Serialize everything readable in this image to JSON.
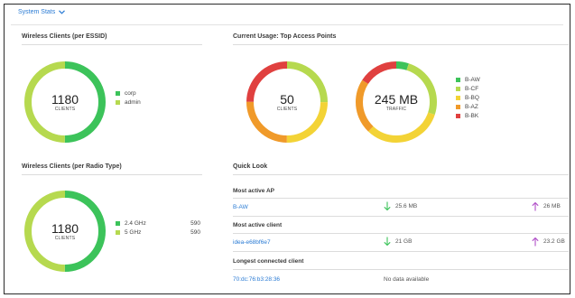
{
  "header": {
    "title": "System Stats"
  },
  "panels": {
    "clients_ssid": {
      "title": "Wireless Clients (per ESSID)",
      "total": "1180",
      "unit": "CLIENTS",
      "legend": [
        {
          "label": "corp",
          "color": "#3cc35a",
          "fraction": 0.5
        },
        {
          "label": "admin",
          "color": "#b6d94f",
          "fraction": 0.5
        }
      ]
    },
    "top_aps": {
      "title": "Current Usage: Top Access Points",
      "clients_total": "50",
      "clients_unit": "CLIENTS",
      "traffic_total": "245 MB",
      "traffic_unit": "TRAFFIC",
      "legend": [
        {
          "label": "B-AW",
          "color": "#3cc35a"
        },
        {
          "label": "B-CF",
          "color": "#b6d94f"
        },
        {
          "label": "B-BQ",
          "color": "#f3d336"
        },
        {
          "label": "B-AZ",
          "color": "#f09a2a"
        },
        {
          "label": "B-BK",
          "color": "#e0403f"
        }
      ],
      "clients_fractions": [
        0.0,
        0.25,
        0.25,
        0.25,
        0.25
      ],
      "traffic_fractions": [
        0.05,
        0.25,
        0.32,
        0.22,
        0.16
      ]
    },
    "clients_radio": {
      "title": "Wireless Clients (per Radio Type)",
      "total": "1180",
      "unit": "CLIENTS",
      "legend": [
        {
          "label": "2.4 GHz",
          "count": "590",
          "color": "#3cc35a",
          "fraction": 0.5
        },
        {
          "label": "5 GHz",
          "count": "590",
          "color": "#b6d94f",
          "fraction": 0.5
        }
      ]
    },
    "quick_look": {
      "title": "Quick Look",
      "most_active_ap": {
        "label": "Most active AP",
        "name": "B-AW",
        "down": "25.6 MB",
        "up": "26 MB"
      },
      "most_active_client": {
        "label": "Most active client",
        "name": "idea-e68bf6e7",
        "down": "21 GB",
        "up": "23.2 GB"
      },
      "longest_client": {
        "label": "Longest connected client",
        "name": "70:dc:76:b3:28:36",
        "value": "No data available"
      }
    }
  },
  "colors": {
    "link": "#2a7bd4",
    "down_arrow": "#3cc35a",
    "up_arrow": "#b04fc8"
  }
}
